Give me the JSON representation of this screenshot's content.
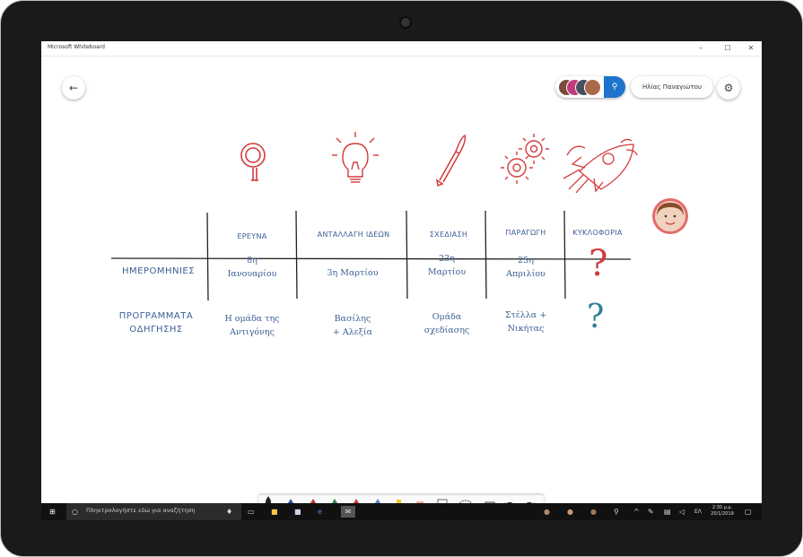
{
  "window": {
    "title": "Microsoft Whiteboard",
    "controls": {
      "minimize": "–",
      "maximize": "☐",
      "close": "✕"
    }
  },
  "header": {
    "back_icon": "arrow-left",
    "invite_icon": "person-add",
    "user_name": "Ηλίας Παναγιώτου",
    "settings_icon": "gear"
  },
  "board": {
    "columns": [
      "ΕΡΕΥΝΑ",
      "ΑΝΤΑΛΛΑΓΗ ΙΔΕΩΝ",
      "ΣΧΕΔΙΑΣΗ",
      "ΠΑΡΑΓΩΓΗ",
      "ΚΥΚΛΟΦΟΡΙΑ"
    ],
    "column_icons": [
      "magnifier",
      "lightbulb",
      "paintbrush",
      "gears",
      "rocket"
    ],
    "rows": [
      {
        "label_lines": [
          "ΗΜΕΡΟΜΗΝΙΕΣ"
        ],
        "cells": [
          [
            "8η",
            "Ιανουαρίου"
          ],
          [
            "3η Μαρτίου"
          ],
          [
            "23η",
            "Μαρτίου"
          ],
          [
            "25η",
            "Απριλίου"
          ],
          [
            "?"
          ]
        ]
      },
      {
        "label_lines": [
          "ΠΡΟΓΡΑΜΜΑΤΑ",
          "ΟΔΗΓΗΣΗΣ"
        ],
        "cells": [
          [
            "Η ομάδα της",
            "Αντιγόνης"
          ],
          [
            "Βασίλης",
            "+ Αλεξία"
          ],
          [
            "Ομάδα",
            "σχεδίασης"
          ],
          [
            "Στέλλα +",
            "Νικήτας"
          ],
          [
            "?"
          ]
        ]
      }
    ],
    "colors": {
      "ink_blue": "#3a5f95",
      "ink_red": "#d43b3b",
      "ink_teal": "#2f7f94",
      "grid": "#222222"
    }
  },
  "toolbar": {
    "tools": [
      "pen-black",
      "pen-blue",
      "pen-red",
      "pen-green",
      "pen-red",
      "pen-blue",
      "highlighter-yellow",
      "eraser",
      "ruler",
      "lasso",
      "add",
      "undo",
      "redo"
    ]
  },
  "taskbar": {
    "search_placeholder": "Πληκτρολογήστε εδώ για αναζήτηση",
    "time": "2:30 μ.μ.",
    "date": "20/1/2019"
  }
}
